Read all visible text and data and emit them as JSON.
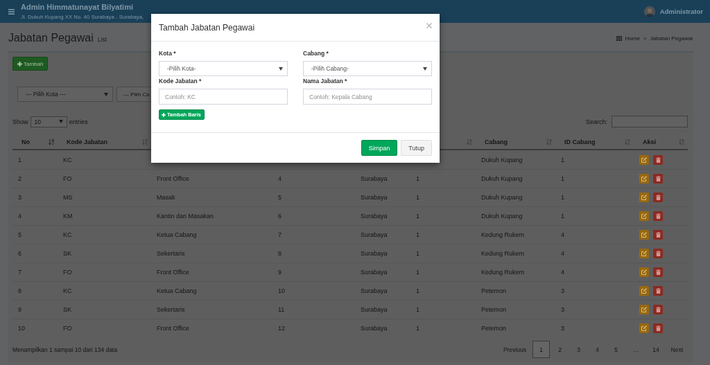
{
  "header": {
    "title": "Admin Himmatunayat Bilyatimi",
    "subtitle": "Jl. Dukuh Kupang XX No. 40 Surabaya - Surabaya,",
    "user": "Administrator"
  },
  "content_header": {
    "title": "Jabatan Pegawai",
    "subtitle": "List",
    "breadcrumb": [
      "Home",
      "Jabatan Pegawai"
    ],
    "separator": ">"
  },
  "toolbar": {
    "add_button": "Tambah",
    "filters": [
      {
        "value": "--- Pilih Kota ---",
        "caret": true
      },
      {
        "value": "--- Pilih Ca",
        "caret": false
      }
    ]
  },
  "table_controls": {
    "show_label": "Show",
    "page_size": "10",
    "entries_label": "entries",
    "search_label": "Search:"
  },
  "table": {
    "columns": [
      {
        "label": "No",
        "sorted": true
      },
      {
        "label": "Kode Jabatan",
        "sorted": false
      },
      null,
      null,
      null,
      {
        "sorted": false
      },
      {
        "label": "Cabang",
        "sorted": false
      },
      {
        "label": "ID Cabang",
        "sorted": false
      },
      {
        "label": "Aksi",
        "sorted": false
      }
    ],
    "rows": [
      [
        "1",
        "KC",
        null,
        null,
        null,
        null,
        "Dukuh Kupang",
        "1"
      ],
      [
        "2",
        "FO",
        "Front Office",
        "4",
        "Surabaya",
        "1",
        "Dukuh Kupang",
        "1"
      ],
      [
        "3",
        "MS",
        "Masak",
        "5",
        "Surabaya",
        "1",
        "Dukuh Kupang",
        "1"
      ],
      [
        "4",
        "KM",
        "Kantin dan Masakan",
        "6",
        "Surabaya",
        "1",
        "Dukuh Kupang",
        "1"
      ],
      [
        "5",
        "KC",
        "Ketua Cabang",
        "7",
        "Surabaya",
        "1",
        "Kedung Rukem",
        "4"
      ],
      [
        "6",
        "SK",
        "Sekertaris",
        "8",
        "Surabaya",
        "1",
        "Kedung Rukem",
        "4"
      ],
      [
        "7",
        "FO",
        "Front Office",
        "9",
        "Surabaya",
        "1",
        "Kedung Rukem",
        "4"
      ],
      [
        "8",
        "KC",
        "Ketua Cabang",
        "10",
        "Surabaya",
        "1",
        "Petemon",
        "3"
      ],
      [
        "9",
        "SK",
        "Sekertaris",
        "11",
        "Surabaya",
        "1",
        "Petemon",
        "3"
      ],
      [
        "10",
        "FO",
        "Front Office",
        "12",
        "Surabaya",
        "1",
        "Petemon",
        "3"
      ]
    ]
  },
  "footer": {
    "info": "Menampilkan 1 sampai 10 dari 134 data",
    "previous": "Previous",
    "pages": [
      {
        "label": "1",
        "kind": "page",
        "selected": true
      },
      {
        "label": "2",
        "kind": "page",
        "selected": false
      },
      {
        "label": "3",
        "kind": "page",
        "selected": false
      },
      {
        "label": "4",
        "kind": "page",
        "selected": false
      },
      {
        "label": "5",
        "kind": "page",
        "selected": false
      },
      {
        "label": "…",
        "kind": "ellipsis",
        "selected": false
      },
      {
        "label": "14",
        "kind": "page",
        "selected": false
      }
    ],
    "next": "Next"
  },
  "modal": {
    "title": "Tambah Jabatan Pegawai",
    "fields": [
      {
        "label": "Kota *",
        "kind": "select",
        "value": "-Pilih Kota-"
      },
      {
        "label": "Cabang *",
        "kind": "select",
        "value": "-Pilih Cabang-"
      },
      {
        "label": "Kode Jabatan *",
        "kind": "input",
        "placeholder": "Contoh: KC"
      },
      {
        "label": "Nama Jabatan *",
        "kind": "input",
        "placeholder": "Contoh: Kepala Cabang"
      }
    ],
    "add_row_button": "Tambah Baris",
    "buttons": [
      {
        "label": "Simpan",
        "kind": "primary"
      },
      {
        "label": "Tutup",
        "kind": "default"
      }
    ]
  }
}
